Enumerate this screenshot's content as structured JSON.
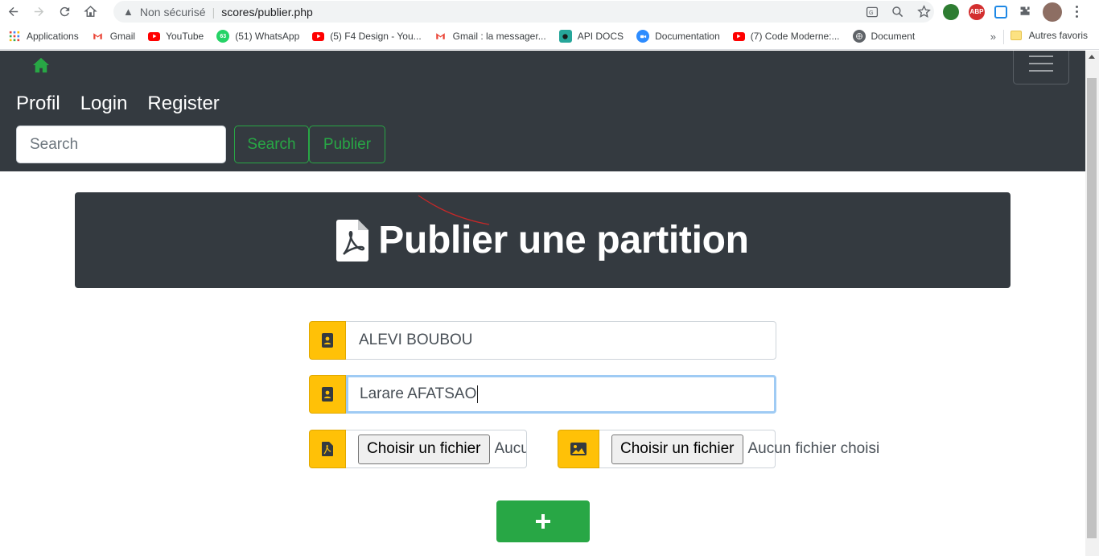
{
  "browser": {
    "security_label": "Non sécurisé",
    "url": "scores/publier.php",
    "bookmarks": [
      {
        "label": "Applications",
        "icon": "apps-grid-icon"
      },
      {
        "label": "Gmail",
        "icon": "gmail-icon"
      },
      {
        "label": "YouTube",
        "icon": "youtube-icon"
      },
      {
        "label": "(51) WhatsApp",
        "icon": "whatsapp-icon"
      },
      {
        "label": "(5) F4 Design - You...",
        "icon": "youtube-icon"
      },
      {
        "label": "Gmail : la messager...",
        "icon": "gmail-icon"
      },
      {
        "label": "API DOCS",
        "icon": "api-docs-icon"
      },
      {
        "label": "Documentation",
        "icon": "zoom-icon"
      },
      {
        "label": "(7) Code Moderne:...",
        "icon": "youtube-icon"
      },
      {
        "label": "Document",
        "icon": "globe-icon"
      }
    ],
    "whatsapp_badge": "63",
    "more_bookmarks": "»",
    "other_bookmarks": "Autres favoris",
    "extension_badge": "ABP"
  },
  "navbar": {
    "links": [
      "Profil",
      "Login",
      "Register"
    ],
    "search_placeholder": "Search",
    "search_button": "Search",
    "publish_button": "Publier"
  },
  "hero": {
    "title": "Publier une partition"
  },
  "form": {
    "field1_value": "ALEVI BOUBOU",
    "field2_value": "Larare AFATSAO",
    "file1_button": "Choisir un fichier",
    "file1_status": "Aucun fichier choisi",
    "file2_button": "Choisir un fichier",
    "file2_status": "Aucun fichier choisi",
    "submit_symbol": "+"
  },
  "colors": {
    "navbar_bg": "#343a40",
    "accent_green": "#28a745",
    "addon_yellow": "#ffc107",
    "focus_ring": "#9fcbf4"
  }
}
